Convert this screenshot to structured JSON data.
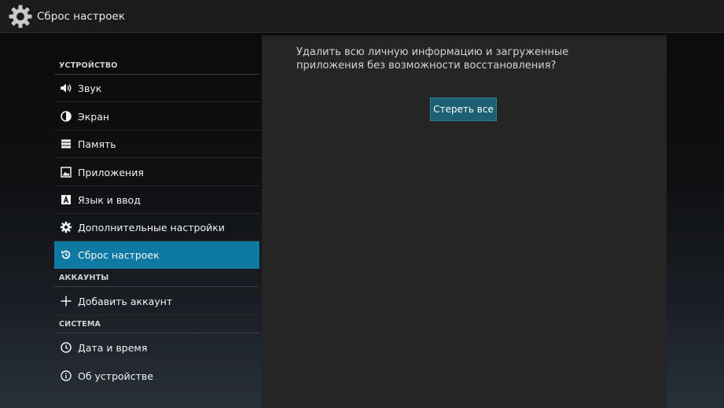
{
  "actionbar": {
    "title": "Сброс настроек",
    "icon": "gear-icon"
  },
  "sidebar": {
    "sections": [
      {
        "title": "УСТРОЙСТВО"
      },
      {
        "title": "АККАУНТЫ"
      },
      {
        "title": "СИСТЕМА"
      }
    ],
    "items": [
      {
        "label": "Звук",
        "icon": "speaker-icon"
      },
      {
        "label": "Экран",
        "icon": "brightness-icon"
      },
      {
        "label": "Память",
        "icon": "storage-icon"
      },
      {
        "label": "Приложения",
        "icon": "apps-icon"
      },
      {
        "label": "Язык и ввод",
        "icon": "keyboard-icon"
      },
      {
        "label": "Дополнительные настройки",
        "icon": "gear-icon"
      },
      {
        "label": "Сброс настроек",
        "icon": "reset-icon",
        "selected": true
      },
      {
        "label": "Добавить аккаунт",
        "icon": "plus-icon"
      },
      {
        "label": "Дата и время",
        "icon": "clock-icon"
      },
      {
        "label": "Об устройстве",
        "icon": "info-icon"
      }
    ]
  },
  "content": {
    "message": "Удалить всю личную информацию и загруженные приложения без возможности восстановления?",
    "button_label": "Стереть все"
  },
  "colors": {
    "selected": "#0e7aa3",
    "button": "#1d5f73",
    "panel": "#252525",
    "actionbar": "#1b1b1b"
  }
}
